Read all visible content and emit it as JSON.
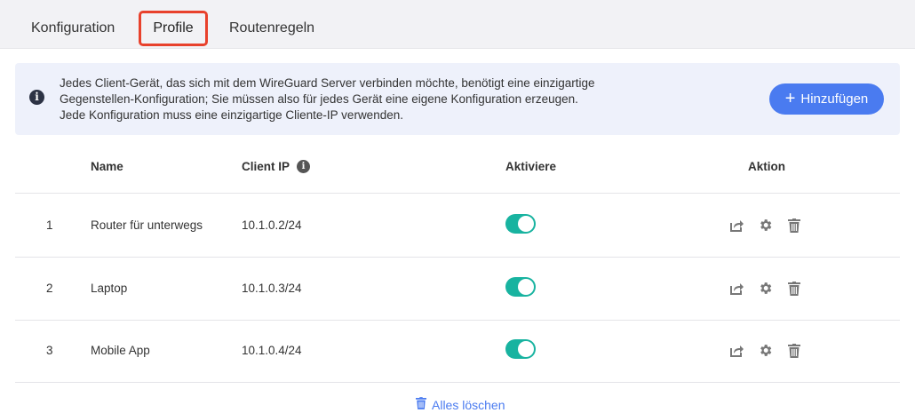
{
  "tabs": [
    {
      "label": "Konfiguration"
    },
    {
      "label": "Profile"
    },
    {
      "label": "Routenregeln"
    }
  ],
  "info": {
    "lines": [
      "Jedes Client-Gerät, das sich mit dem WireGuard Server verbinden möchte, benötigt eine einzigartige",
      "Gegenstellen-Konfiguration; Sie müssen also für jedes Gerät eine eigene Konfiguration erzeugen.",
      "Jede Konfiguration muss eine einzigartige Cliente-IP verwenden."
    ],
    "icon": "info-icon",
    "add_button": "Hinzufügen"
  },
  "table": {
    "headers": {
      "name": "Name",
      "client_ip": "Client IP",
      "activate": "Aktiviere",
      "action": "Aktion"
    },
    "rows": [
      {
        "num": "1",
        "name": "Router für unterwegs",
        "ip": "10.1.0.2/24",
        "enabled": true
      },
      {
        "num": "2",
        "name": "Laptop",
        "ip": "10.1.0.3/24",
        "enabled": true
      },
      {
        "num": "3",
        "name": "Mobile App",
        "ip": "10.1.0.4/24",
        "enabled": true
      }
    ]
  },
  "footer": {
    "delete_all": "Alles löschen"
  },
  "colors": {
    "accent": "#4a7bf0",
    "toggle_on": "#18b3a0",
    "tab_highlight": "#e8412c",
    "info_bg": "#eef1fb"
  },
  "icons": [
    "info-icon",
    "plus-icon",
    "export-icon",
    "gear-icon",
    "trash-icon"
  ]
}
